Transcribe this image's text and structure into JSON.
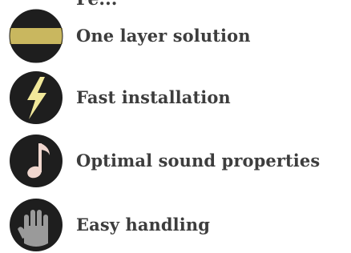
{
  "page": {
    "heading_partial": "Fe... ",
    "features": [
      {
        "icon": "layer-icon",
        "label": "One layer solution"
      },
      {
        "icon": "lightning-icon",
        "label": "Fast installation"
      },
      {
        "icon": "music-note-icon",
        "label": "Optimal sound properties"
      },
      {
        "icon": "hand-icon",
        "label": "Easy handling"
      }
    ]
  },
  "colors": {
    "circle": "#1e1e1e",
    "gold": "#c9b75f",
    "yellow": "#f1e89a",
    "note": "#f0d7cf",
    "hand": "#9a9a9a",
    "text": "#3d3d3d"
  }
}
